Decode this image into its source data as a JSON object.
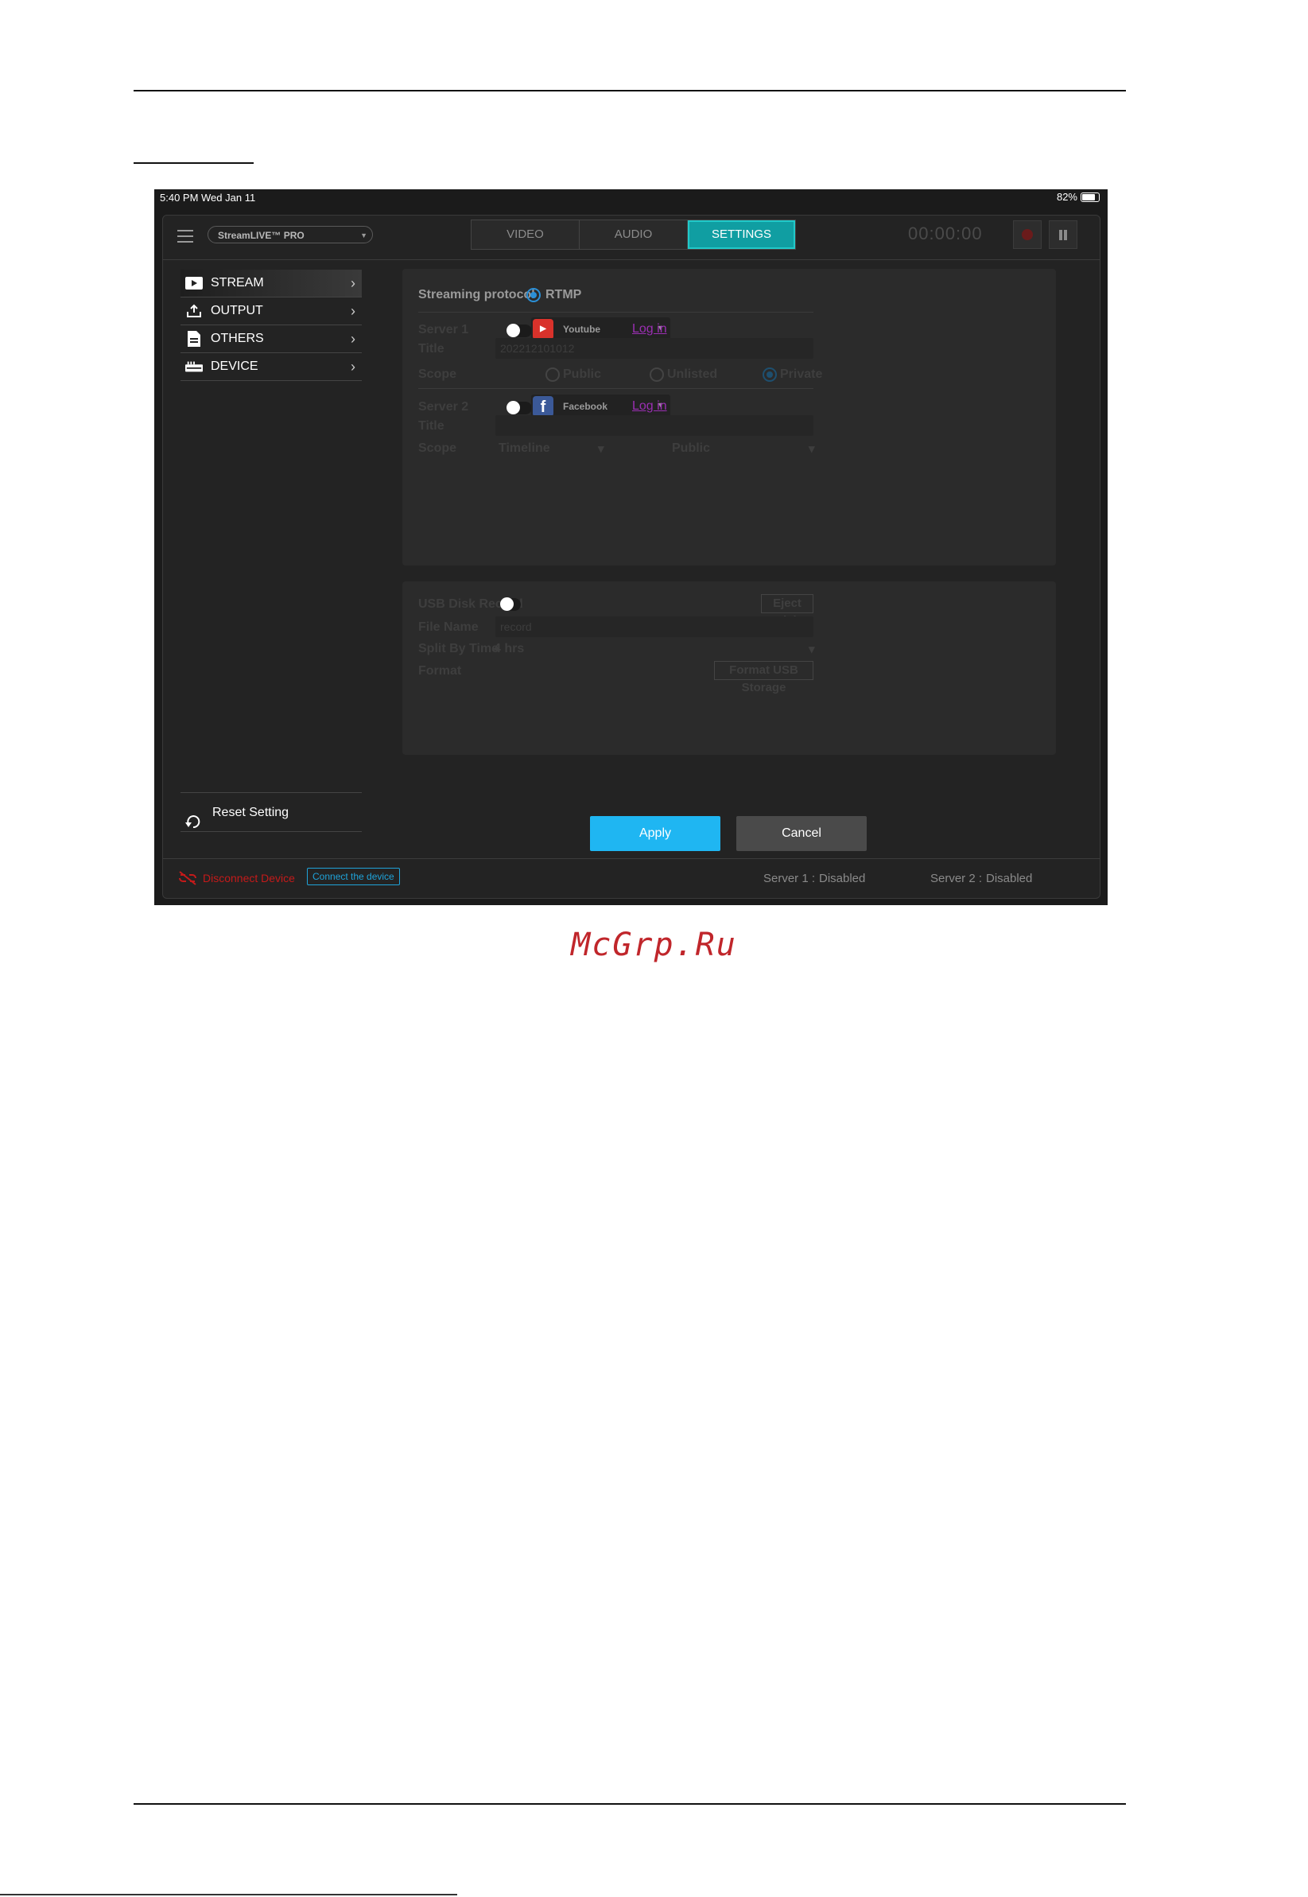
{
  "status_bar": {
    "time": "5:40 PM  Wed Jan 11",
    "battery": "82%"
  },
  "header": {
    "device": "StreamLIVE™ PRO",
    "tabs": [
      {
        "label": "VIDEO"
      },
      {
        "label": "AUDIO"
      },
      {
        "label": "SETTINGS"
      }
    ],
    "active_tab": "SETTINGS",
    "timer": "00:00:00"
  },
  "sidebar": {
    "items": [
      {
        "label": "STREAM",
        "icon": "play-icon"
      },
      {
        "label": "OUTPUT",
        "icon": "upload-icon"
      },
      {
        "label": "OTHERS",
        "icon": "document-icon"
      },
      {
        "label": "DEVICE",
        "icon": "device-icon"
      }
    ],
    "reset_label": "Reset Setting"
  },
  "stream": {
    "protocol_label": "Streaming protocol",
    "protocol_value": "RTMP",
    "server1": {
      "label": "Server 1",
      "platform": "Youtube",
      "login": "Log in",
      "title_label": "Title",
      "title_value": "202212101012",
      "scope_label": "Scope",
      "scope_options": [
        "Public",
        "Unlisted",
        "Private"
      ],
      "scope_selected": "Private"
    },
    "server2": {
      "label": "Server 2",
      "platform": "Facebook",
      "login": "Log in",
      "title_label": "Title",
      "title_value": "",
      "scope_label": "Scope",
      "scope_timeline": "Timeline",
      "scope_privacy": "Public"
    }
  },
  "record": {
    "usb_label": "USB Disk Record",
    "eject": "Eject Disk",
    "filename_label": "File Name",
    "filename_value": "record",
    "split_label": "Split By Time",
    "split_value": "4 hrs",
    "format_label": "Format",
    "format_button": "Format USB Storage"
  },
  "actions": {
    "apply": "Apply",
    "cancel": "Cancel"
  },
  "bottom": {
    "disconnect": "Disconnect Device",
    "connect": "Connect the device",
    "server1_label": "Server 1 :",
    "server1_value": "Disabled",
    "server2_label": "Server 2 :",
    "server2_value": "Disabled"
  },
  "watermark": "McGrp.Ru",
  "colors": {
    "accent_teal": "#109ea2",
    "apply_blue": "#1fb6f2",
    "error_red": "#c41a1a",
    "link_purple": "#9b2fb3"
  }
}
